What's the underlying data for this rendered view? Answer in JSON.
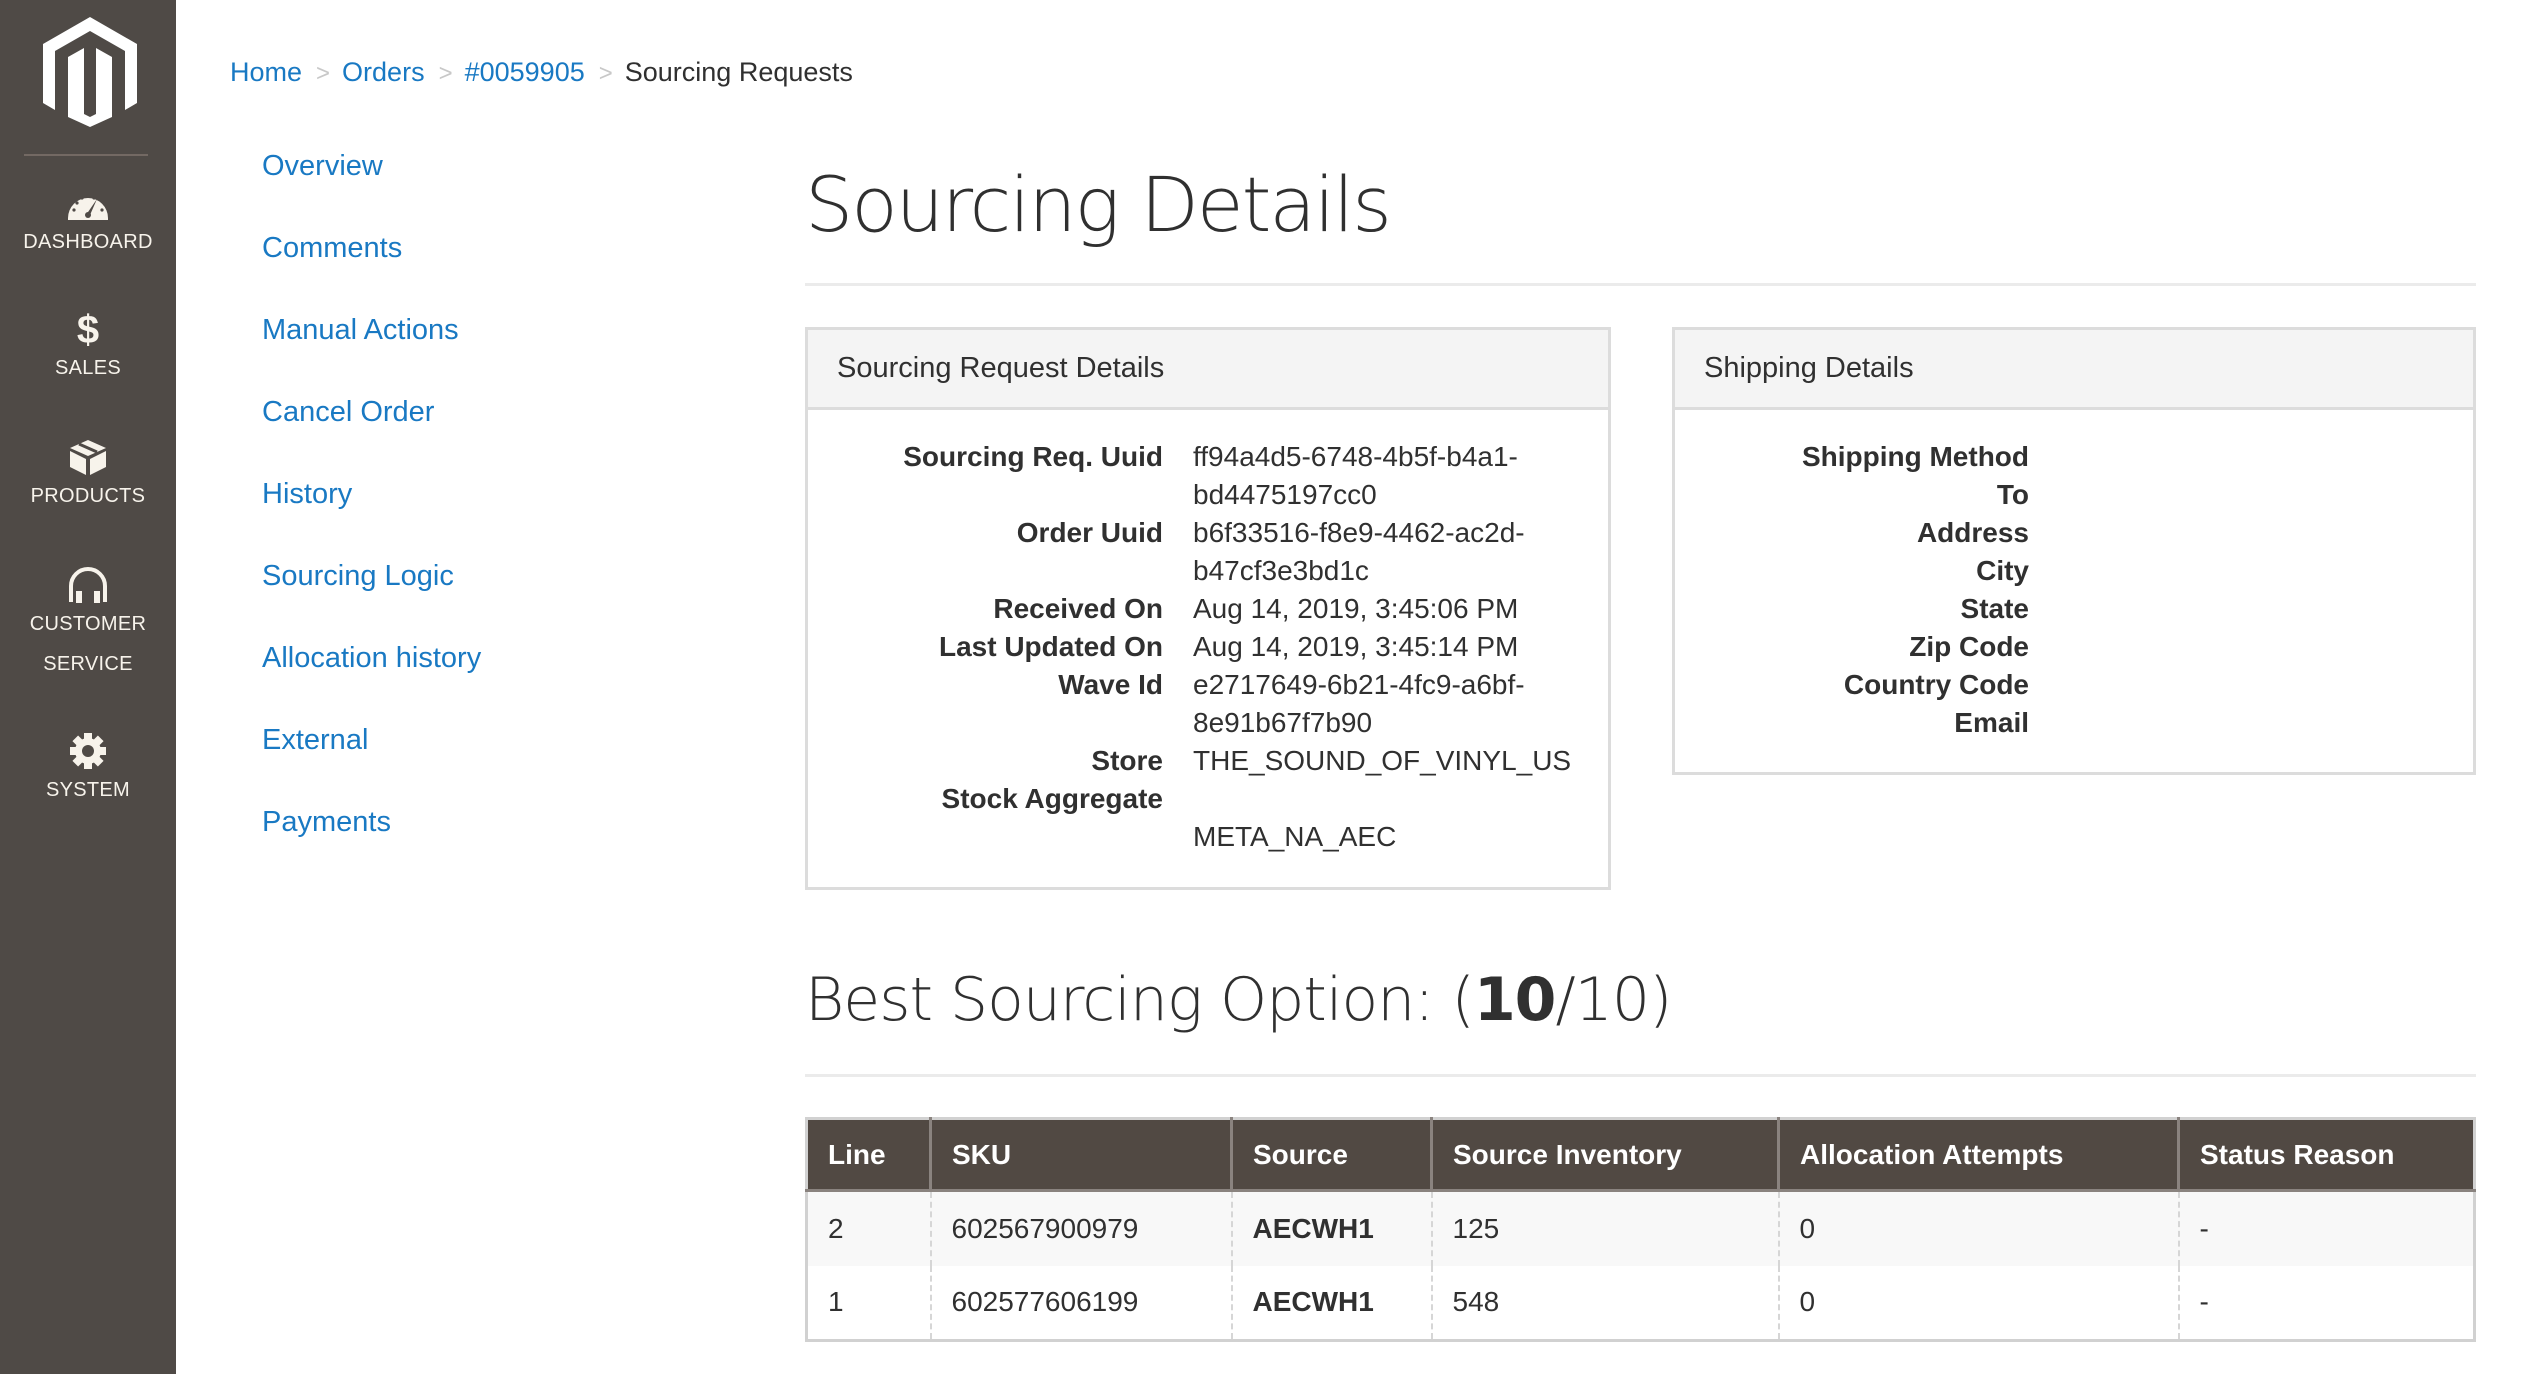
{
  "sidebar": {
    "logo": "magento-logo",
    "items": [
      {
        "label": "DASHBOARD",
        "icon": "dashboard-gauge-icon"
      },
      {
        "label": "SALES",
        "icon": "dollar-icon"
      },
      {
        "label": "PRODUCTS",
        "icon": "box-icon"
      },
      {
        "label": "CUSTOMER",
        "label2": "SERVICE",
        "icon": "headset-icon"
      },
      {
        "label": "SYSTEM",
        "icon": "gear-icon"
      }
    ]
  },
  "breadcrumb": {
    "items": [
      "Home",
      "Orders",
      "#0059905"
    ],
    "separator": ">",
    "current": "Sourcing Requests"
  },
  "left_menu": {
    "items": [
      "Overview",
      "Comments",
      "Manual Actions",
      "Cancel Order",
      "History",
      "Sourcing Logic",
      "Allocation history",
      "External",
      "Payments"
    ]
  },
  "page": {
    "title": "Sourcing Details"
  },
  "sourcing_request_panel": {
    "title": "Sourcing Request Details",
    "fields": [
      {
        "label": "Sourcing Req. Uuid",
        "value": "ff94a4d5-6748-4b5f-b4a1-\nbd4475197cc0"
      },
      {
        "label": "Order Uuid",
        "value": "b6f33516-f8e9-4462-ac2d-\nb47cf3e3bd1c"
      },
      {
        "label": "Received On",
        "value": "Aug 14, 2019, 3:45:06 PM"
      },
      {
        "label": "Last Updated On",
        "value": "Aug 14, 2019, 3:45:14 PM"
      },
      {
        "label": "Wave Id",
        "value": "e2717649-6b21-4fc9-a6bf-\n8e91b67f7b90"
      },
      {
        "label": "Store",
        "value": "THE_SOUND_OF_VINYL_US"
      },
      {
        "label": "Stock Aggregate",
        "value": "\nMETA_NA_AEC"
      }
    ]
  },
  "shipping_panel": {
    "title": "Shipping Details",
    "fields": [
      {
        "label": "Shipping Method",
        "value": ""
      },
      {
        "label": "To",
        "value": ""
      },
      {
        "label": "Address",
        "value": ""
      },
      {
        "label": "City",
        "value": ""
      },
      {
        "label": "State",
        "value": ""
      },
      {
        "label": "Zip Code",
        "value": ""
      },
      {
        "label": "Country Code",
        "value": ""
      },
      {
        "label": "Email",
        "value": ""
      }
    ]
  },
  "best_sourcing": {
    "prefix": "Best Sourcing Option: (",
    "score": "10",
    "suffix": "/10)"
  },
  "table": {
    "columns": [
      "Line",
      "SKU",
      "Source",
      "Source Inventory",
      "Allocation Attempts",
      "Status Reason"
    ],
    "rows": [
      {
        "line": "2",
        "sku": "602567900979",
        "source": "AECWH1",
        "source_inventory": "125",
        "allocation_attempts": "0",
        "status_reason": "-"
      },
      {
        "line": "1",
        "sku": "602577606199",
        "source": "AECWH1",
        "source_inventory": "548",
        "allocation_attempts": "0",
        "status_reason": "-"
      }
    ]
  },
  "colors": {
    "sidebar_bg": "#4f4a46",
    "link": "#1979c3",
    "table_header_bg": "#514943",
    "text": "#303030"
  }
}
